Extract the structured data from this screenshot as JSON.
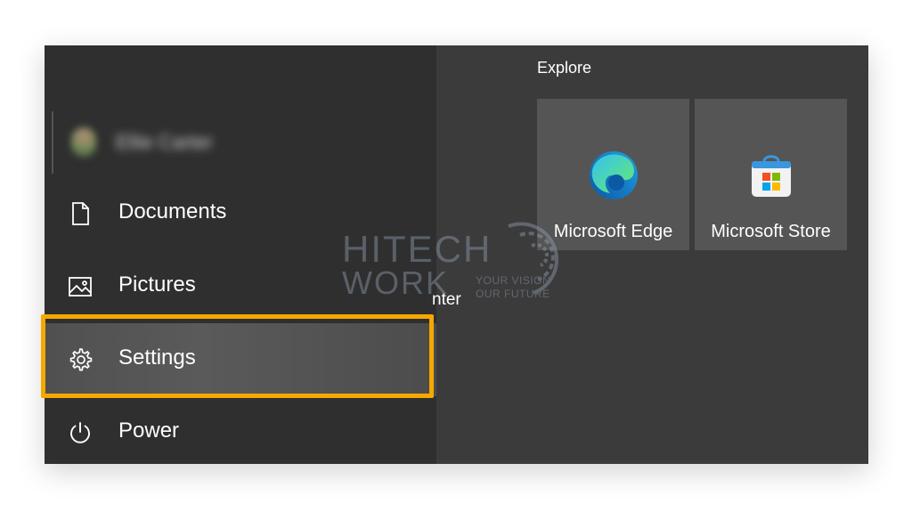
{
  "left_pane": {
    "user": {
      "name": "Ellie Carter"
    },
    "items": [
      {
        "label": "Documents",
        "icon": "document-icon"
      },
      {
        "label": "Pictures",
        "icon": "pictures-icon"
      },
      {
        "label": "Settings",
        "icon": "gear-icon",
        "highlighted": true
      },
      {
        "label": "Power",
        "icon": "power-icon"
      }
    ]
  },
  "right_pane": {
    "section_title": "Explore",
    "tiles": [
      {
        "label": "Microsoft Edge",
        "icon": "edge-icon"
      },
      {
        "label": "Microsoft Store",
        "icon": "store-icon"
      }
    ],
    "partial_text": "nter"
  },
  "watermark": {
    "line1": "HITECH",
    "line2": "WORK",
    "tagline1": "YOUR VISION",
    "tagline2": "OUR FUTURE"
  },
  "colors": {
    "highlight": "#f5a800",
    "menu_background": "#3a3a3a",
    "tile_background": "#555555"
  }
}
